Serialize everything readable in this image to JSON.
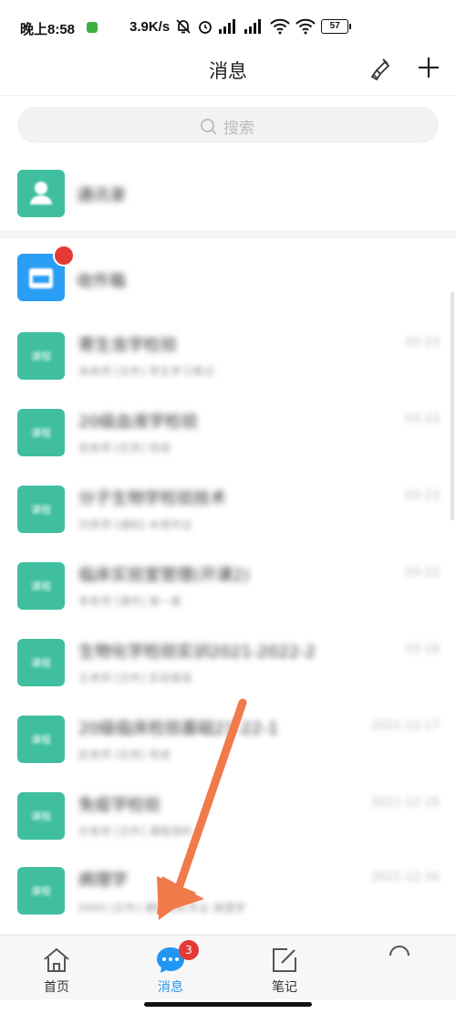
{
  "status_bar": {
    "time": "晚上8:58",
    "net_speed": "3.9K/s",
    "battery": "57"
  },
  "header": {
    "title": "消息"
  },
  "search": {
    "placeholder": "搜索"
  },
  "contacts": {
    "label": "通讯录"
  },
  "notice": {
    "label": "收件箱"
  },
  "chats": [
    {
      "title": "寄生虫学检验",
      "subtitle": "张老师 [文件] 学生学习笔记",
      "date": "03-23",
      "avatar_text": "课程"
    },
    {
      "title": "20级血液学检验",
      "subtitle": "张老师 [任务] 完成",
      "date": "03-23",
      "avatar_text": "课程"
    },
    {
      "title": "分子生物学检验技术",
      "subtitle": "刘老师 [通知] 本周作业",
      "date": "03-23",
      "avatar_text": "课程"
    },
    {
      "title": "临床实验室管理(开课2)",
      "subtitle": "李老师 [课件] 第一章",
      "date": "03-22",
      "avatar_text": "课程"
    },
    {
      "title": "生物化学检验实训2021-2022-2",
      "subtitle": "王老师 [文件] 实验报告",
      "date": "03-18",
      "avatar_text": "课程"
    },
    {
      "title": "20级临床检验基础21-22-1",
      "subtitle": "赵老师 [任务] 完成",
      "date": "2021-12-17",
      "avatar_text": "课程"
    },
    {
      "title": "免疫学检验",
      "subtitle": "孙老师 [文件] 课程资料",
      "date": "2021-12-16",
      "avatar_text": "课程"
    },
    {
      "title": "病理学",
      "subtitle": "0900 [文件] 课程资料专业 病理学",
      "date": "2021-12-16",
      "avatar_text": "课程"
    }
  ],
  "tabbar": {
    "tabs": [
      {
        "label": "首页"
      },
      {
        "label": "消息"
      },
      {
        "label": "笔记"
      },
      {
        "label": ""
      }
    ],
    "message_badge": "3"
  },
  "colors": {
    "accent": "#2196f3",
    "avatar_green": "#3fbf9f",
    "badge_red": "#e53935",
    "arrow_orange": "#f07a4a"
  }
}
